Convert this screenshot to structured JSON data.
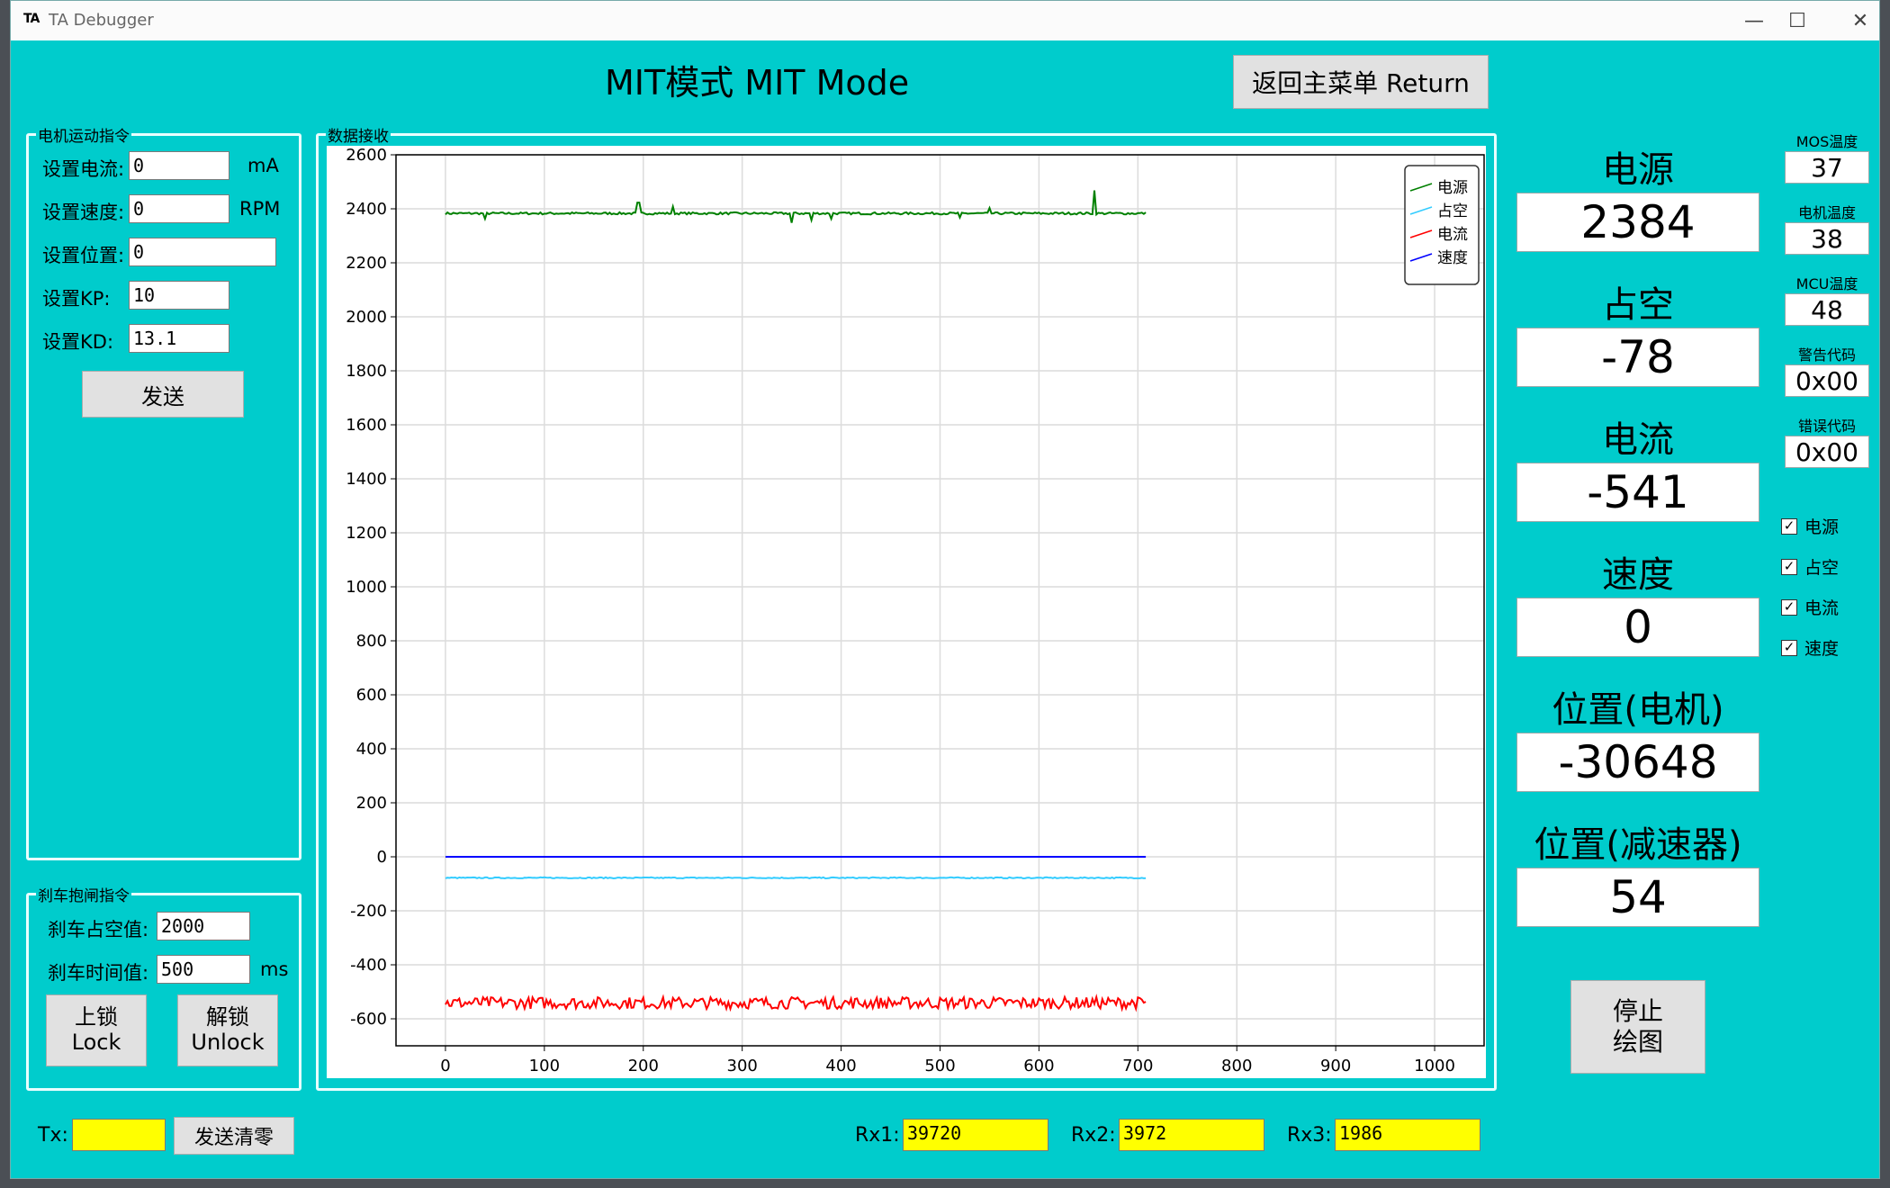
{
  "window": {
    "icon": "TA",
    "title": "TA Debugger",
    "controls": [
      "—",
      "☐",
      "✕"
    ]
  },
  "page_title": "MIT模式 MIT Mode",
  "return_button": "返回主菜单 Return",
  "motion": {
    "title": "电机运动指令",
    "fields": [
      {
        "label": "设置电流:",
        "value": "0",
        "unit": "mA"
      },
      {
        "label": "设置速度:",
        "value": "0",
        "unit": "RPM"
      },
      {
        "label": "设置位置:",
        "value": "0",
        "unit": ""
      },
      {
        "label": "设置KP:",
        "value": "10",
        "unit": ""
      },
      {
        "label": "设置KD:",
        "value": "13.1",
        "unit": ""
      }
    ],
    "send_button": "发送"
  },
  "brake": {
    "title": "刹车抱闸指令",
    "duty_label": "刹车占空值:",
    "duty_value": "2000",
    "time_label": "刹车时间值:",
    "time_value": "500",
    "time_unit": "ms",
    "lock_button": [
      "上锁",
      "Lock"
    ],
    "unlock_button": [
      "解锁",
      "Unlock"
    ]
  },
  "chart_group_title": "数据接收",
  "chart_data": {
    "type": "line",
    "xlim": [
      -50,
      1050
    ],
    "ylim": [
      -700,
      2600
    ],
    "x_ticks": [
      0,
      100,
      200,
      300,
      400,
      500,
      600,
      700,
      800,
      900,
      1000
    ],
    "y_ticks": [
      2600,
      2400,
      2200,
      2000,
      1800,
      1600,
      1400,
      1200,
      1000,
      800,
      600,
      400,
      200,
      0,
      -200,
      -400,
      -600
    ],
    "grid": true,
    "legend_position": "top-right",
    "series": [
      {
        "name": "电源",
        "color": "#008000",
        "x_range": [
          0,
          708
        ],
        "base": 2383,
        "noise": 4,
        "spikes": [
          [
            40,
            -20
          ],
          [
            195,
            40
          ],
          [
            230,
            25
          ],
          [
            350,
            -35
          ],
          [
            370,
            -25
          ],
          [
            390,
            -20
          ],
          [
            520,
            -15
          ],
          [
            550,
            20
          ],
          [
            656,
            85
          ]
        ]
      },
      {
        "name": "占空",
        "color": "#33ccff",
        "x_range": [
          0,
          708
        ],
        "base": -78,
        "noise": 2,
        "spikes": []
      },
      {
        "name": "电流",
        "color": "#ff0000",
        "x_range": [
          0,
          708
        ],
        "base": -541,
        "noise": 22,
        "spikes": []
      },
      {
        "name": "速度",
        "color": "#0000ff",
        "x_range": [
          0,
          708
        ],
        "base": 0,
        "noise": 0,
        "spikes": []
      }
    ]
  },
  "readouts": [
    {
      "label": "电源",
      "value": "2384"
    },
    {
      "label": "占空",
      "value": "-78"
    },
    {
      "label": "电流",
      "value": "-541"
    },
    {
      "label": "速度",
      "value": "0"
    },
    {
      "label": "位置(电机)",
      "value": "-30648"
    },
    {
      "label": "位置(减速器)",
      "value": "54"
    }
  ],
  "status": [
    {
      "label": "MOS温度",
      "value": "37"
    },
    {
      "label": "电机温度",
      "value": "38"
    },
    {
      "label": "MCU温度",
      "value": "48"
    },
    {
      "label": "警告代码",
      "value": "0x00"
    },
    {
      "label": "错误代码",
      "value": "0x00"
    }
  ],
  "checkboxes": [
    {
      "label": "电源",
      "checked": true
    },
    {
      "label": "占空",
      "checked": true
    },
    {
      "label": "电流",
      "checked": true
    },
    {
      "label": "速度",
      "checked": true
    }
  ],
  "stop_button": [
    "停止",
    "绘图"
  ],
  "bottom": {
    "tx_label": "Tx:",
    "tx_value": "",
    "clear_button": "发送清零",
    "rx1_label": "Rx1:",
    "rx1_value": "39720",
    "rx2_label": "Rx2:",
    "rx2_value": "3972",
    "rx3_label": "Rx3:",
    "rx3_value": "1986"
  }
}
